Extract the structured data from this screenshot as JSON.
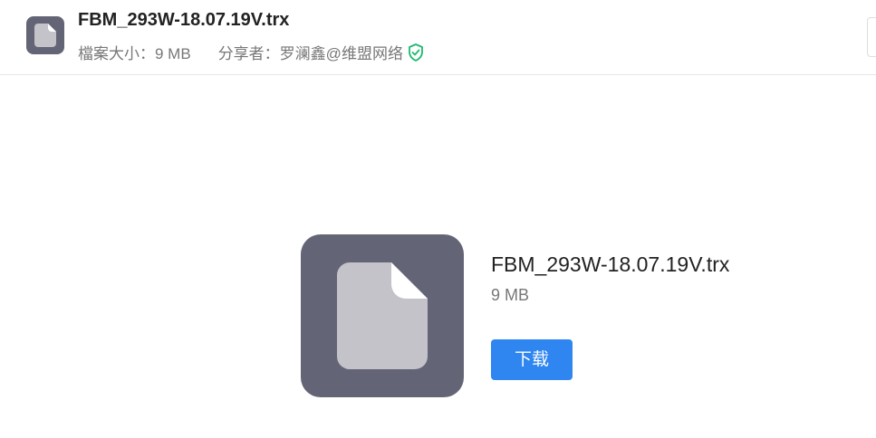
{
  "header": {
    "file_name": "FBM_293W-18.07.19V.trx",
    "size_text": "檔案大小：9 MB",
    "sharer_text": "分享者：罗澜鑫@维盟网络",
    "icon": "file-icon",
    "verified_icon": "shield-check-icon"
  },
  "main": {
    "file_name": "FBM_293W-18.07.19V.trx",
    "file_size": "9 MB",
    "download_label": "下载",
    "icon": "file-icon"
  },
  "colors": {
    "icon_bg": "#636476",
    "icon_fg": "#c3c3c9",
    "accent": "#2f86f0",
    "verified": "#1fb970"
  }
}
